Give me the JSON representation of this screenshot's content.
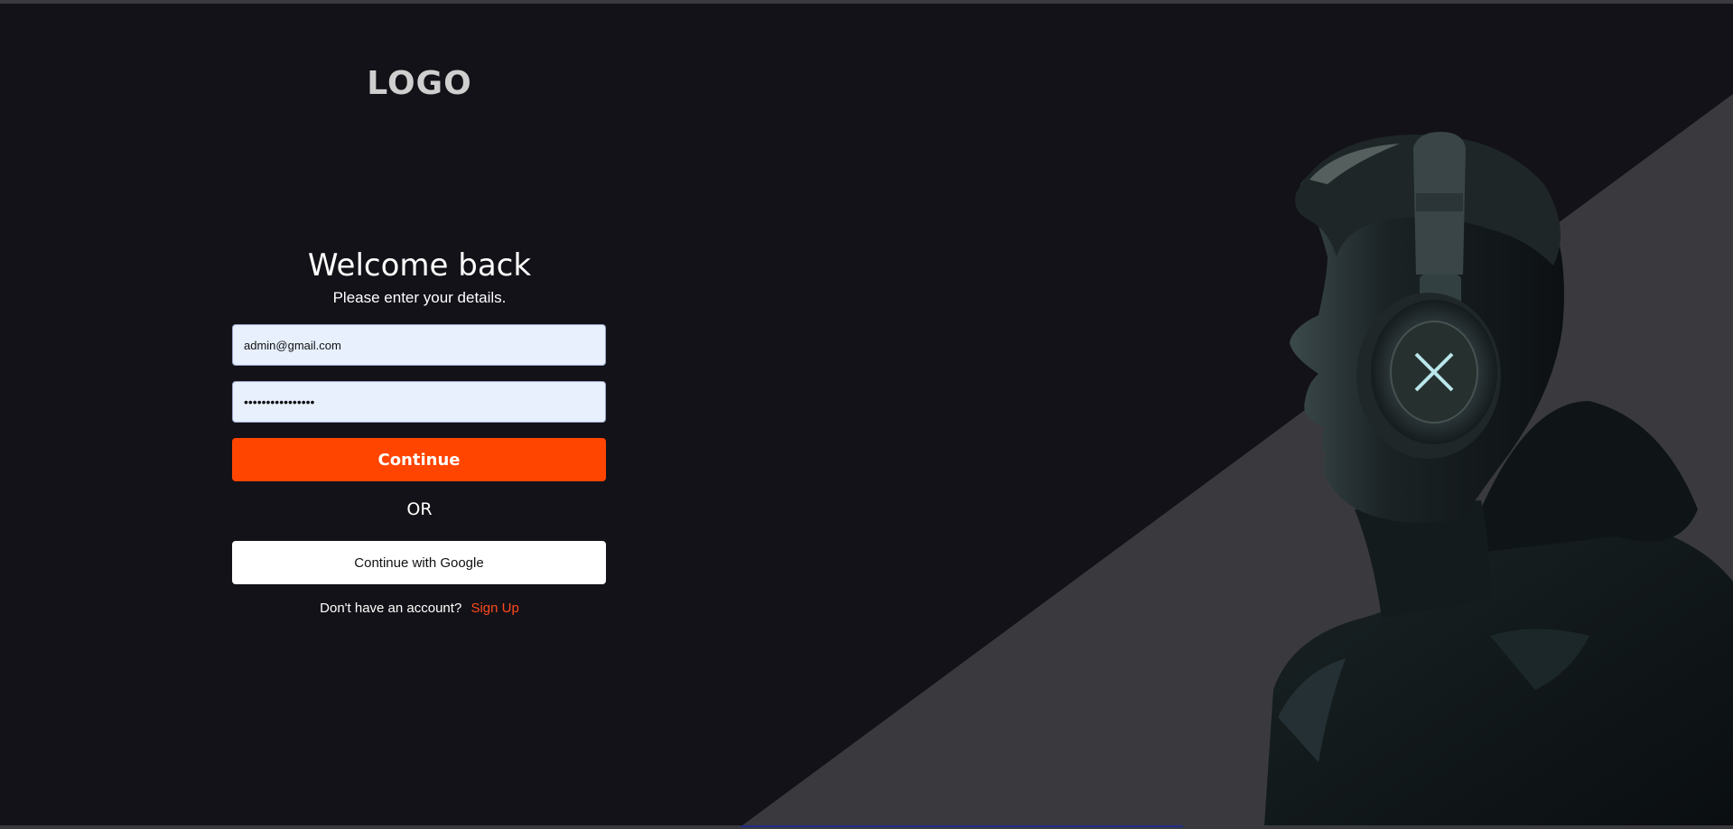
{
  "brand": {
    "logo_text": "LOGO"
  },
  "login": {
    "title": "Welcome back",
    "subtitle": "Please enter your details.",
    "email_value": "admin@gmail.com",
    "password_value": "••••••••••••••••",
    "continue_label": "Continue",
    "or_label": "OR",
    "google_label": "Continue with Google",
    "no_account_text": "Don't have an account?",
    "signup_label": "Sign Up"
  },
  "hero": {
    "image": "man-with-headphones-profile"
  },
  "colors": {
    "background": "#131218",
    "diagonal_panel": "#3a3a3e",
    "accent": "#ff4500",
    "input_bg": "#e8f0fe"
  }
}
